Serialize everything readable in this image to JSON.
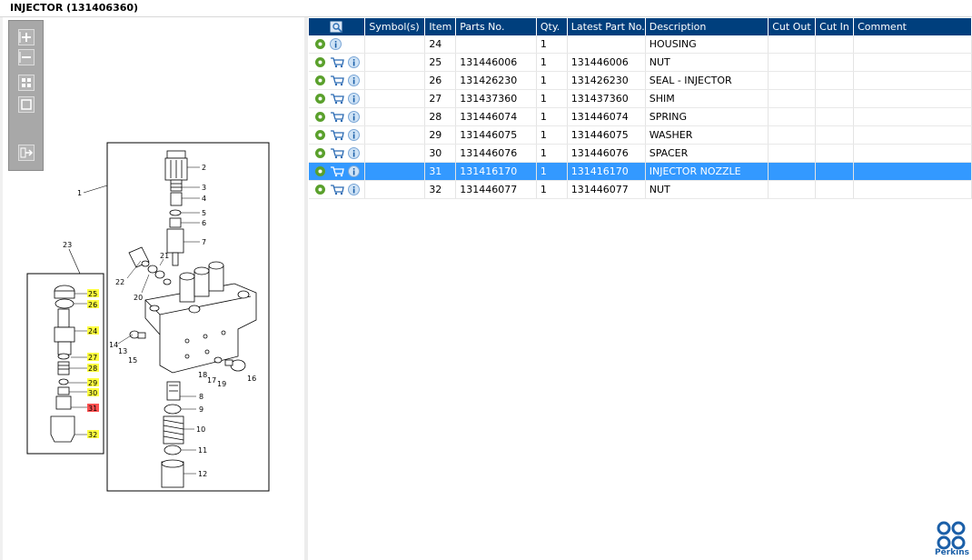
{
  "window": {
    "title": "INJECTOR (131406360)"
  },
  "toolbar": {
    "buttons": [
      "zoom-in-icon",
      "zoom-out-icon",
      "fit-all-icon",
      "fit-window-icon",
      "export-icon"
    ]
  },
  "diagram": {
    "callouts_highlighted": [
      "25",
      "26",
      "24",
      "27",
      "28",
      "29",
      "30",
      "32"
    ],
    "callout_selected": "31",
    "labels": [
      "1",
      "2",
      "3",
      "4",
      "5",
      "6",
      "7",
      "8",
      "9",
      "10",
      "11",
      "12",
      "13",
      "14",
      "15",
      "16",
      "17",
      "18",
      "19",
      "20",
      "21",
      "22",
      "23",
      "24",
      "25",
      "26",
      "27",
      "28",
      "29",
      "30",
      "31",
      "32"
    ]
  },
  "table": {
    "headers": {
      "icon": "",
      "symbols": "Symbol(s)",
      "item": "Item",
      "parts_no": "Parts No.",
      "qty": "Qty.",
      "latest": "Latest Part No.",
      "description": "Description",
      "cut_out": "Cut Out",
      "cut_in": "Cut In",
      "comment": "Comment"
    },
    "rows": [
      {
        "item": "24",
        "parts_no": "",
        "qty": "1",
        "latest": "",
        "description": "HOUSING",
        "cart": false,
        "selected": false
      },
      {
        "item": "25",
        "parts_no": "131446006",
        "qty": "1",
        "latest": "131446006",
        "description": "NUT",
        "cart": true,
        "selected": false
      },
      {
        "item": "26",
        "parts_no": "131426230",
        "qty": "1",
        "latest": "131426230",
        "description": "SEAL - INJECTOR",
        "cart": true,
        "selected": false
      },
      {
        "item": "27",
        "parts_no": "131437360",
        "qty": "1",
        "latest": "131437360",
        "description": "SHIM",
        "cart": true,
        "selected": false
      },
      {
        "item": "28",
        "parts_no": "131446074",
        "qty": "1",
        "latest": "131446074",
        "description": "SPRING",
        "cart": true,
        "selected": false
      },
      {
        "item": "29",
        "parts_no": "131446075",
        "qty": "1",
        "latest": "131446075",
        "description": "WASHER",
        "cart": true,
        "selected": false
      },
      {
        "item": "30",
        "parts_no": "131446076",
        "qty": "1",
        "latest": "131446076",
        "description": "SPACER",
        "cart": true,
        "selected": false
      },
      {
        "item": "31",
        "parts_no": "131416170",
        "qty": "1",
        "latest": "131416170",
        "description": "INJECTOR NOZZLE",
        "cart": true,
        "selected": true
      },
      {
        "item": "32",
        "parts_no": "131446077",
        "qty": "1",
        "latest": "131446077",
        "description": "NUT",
        "cart": true,
        "selected": false
      }
    ]
  },
  "brand": {
    "name": "Perkins",
    "color": "#1b5fa8"
  },
  "colors": {
    "header": "#003f7d",
    "selected_row": "#3399ff",
    "callout": "#ffff40",
    "callout_selected": "#ff5050"
  }
}
